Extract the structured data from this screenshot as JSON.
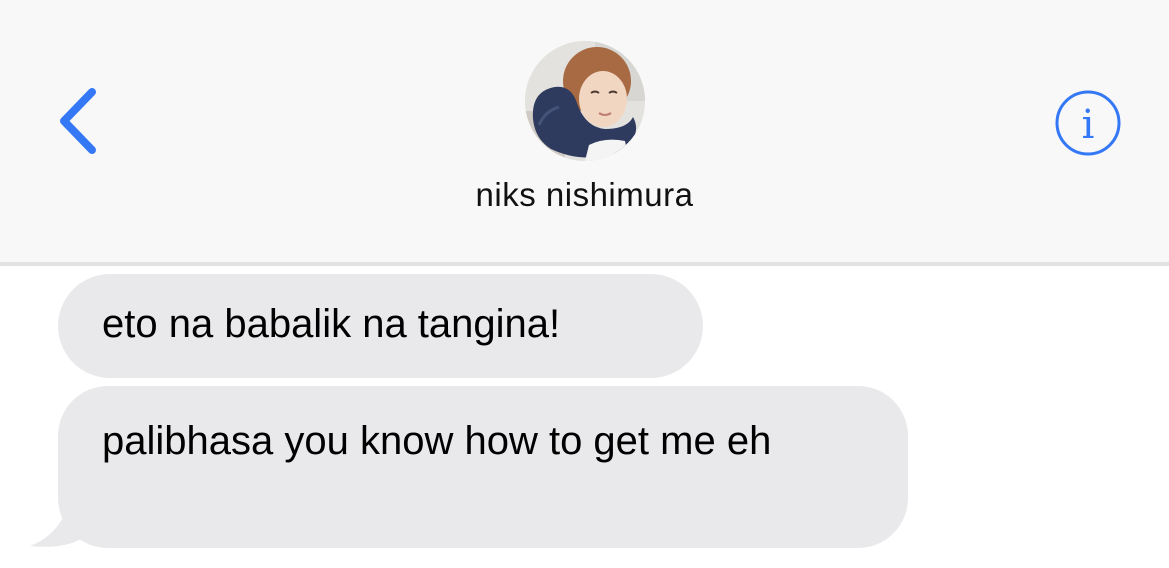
{
  "header": {
    "contact_name": "niks nishimura",
    "back_icon": "chevron-left-icon",
    "info_icon": "info-icon",
    "accent_color": "#3478f6"
  },
  "messages": [
    {
      "text": "eto na babalik na tangina!",
      "direction": "incoming"
    },
    {
      "text": "palibhasa you know how to get me eh",
      "direction": "incoming"
    }
  ],
  "colors": {
    "incoming_bubble": "#e9e9eb",
    "header_background": "#f8f8f8"
  }
}
